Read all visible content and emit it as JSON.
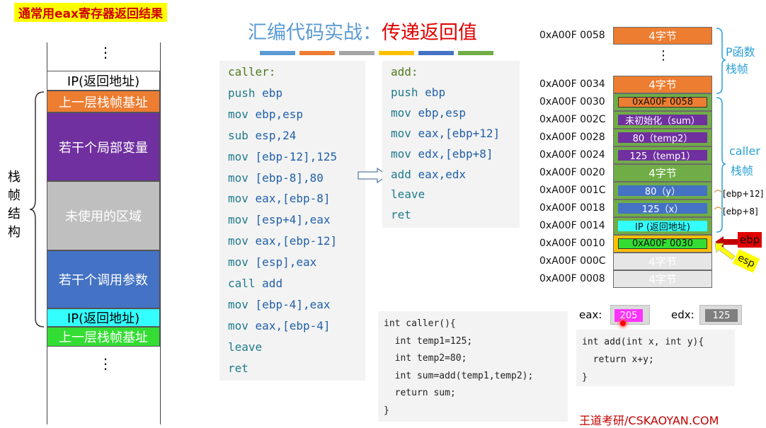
{
  "banner": "通常用eax寄存器返回结果",
  "title": {
    "part1": "汇编代码实战：",
    "part2": "传递返回值"
  },
  "color_bars": [
    "#5b9bd5",
    "#ed7d31",
    "#a5a5a5",
    "#ffc000",
    "#4472c4",
    "#70ad47"
  ],
  "left_stack": {
    "side_label": "栈帧结构",
    "ellipsis": "⋮",
    "rows": [
      {
        "label": "IP(返回地址)",
        "color": "#ffffff",
        "text_color": "#000000"
      },
      {
        "label": "上一层栈帧基址",
        "color": "#ed7d31",
        "text_color": "#ffffff"
      },
      {
        "label": "若干个局部变量",
        "color": "#7030a0",
        "text_color": "#ffffff"
      },
      {
        "label": "未使用的区域",
        "color": "#bfbfbf",
        "text_color": "#ffffff"
      },
      {
        "label": "若干个调用参数",
        "color": "#4472c4",
        "text_color": "#ffffff"
      },
      {
        "label": "IP(返回地址)",
        "color": "#33ffff",
        "text_color": "#000000"
      },
      {
        "label": "上一层栈帧基址",
        "color": "#33dd33",
        "text_color": "#ffffff"
      }
    ]
  },
  "caller_asm": [
    {
      "type": "label",
      "text": "caller:"
    },
    {
      "type": "ins",
      "op": "push",
      "args": "ebp"
    },
    {
      "type": "ins",
      "op": "mov",
      "args": "ebp,esp"
    },
    {
      "type": "ins",
      "op": "sub",
      "args": "esp,24"
    },
    {
      "type": "ins",
      "op": "mov",
      "args": "[ebp-12],125"
    },
    {
      "type": "ins",
      "op": "mov",
      "args": "[ebp-8],80"
    },
    {
      "type": "ins",
      "op": "mov",
      "args": "eax,[ebp-8]"
    },
    {
      "type": "ins",
      "op": "mov",
      "args": "[esp+4],eax"
    },
    {
      "type": "ins",
      "op": "mov",
      "args": "eax,[ebp-12]"
    },
    {
      "type": "ins",
      "op": "mov",
      "args": "[esp],eax"
    },
    {
      "type": "ins",
      "op": "call",
      "args": "add"
    },
    {
      "type": "ins",
      "op": "mov",
      "args": "[ebp-4],eax"
    },
    {
      "type": "ins",
      "op": "mov",
      "args": "eax,[ebp-4]"
    },
    {
      "type": "ins",
      "op": "leave",
      "args": ""
    },
    {
      "type": "ins",
      "op": "ret",
      "args": ""
    }
  ],
  "add_asm": [
    {
      "type": "label",
      "text": "add:"
    },
    {
      "type": "ins",
      "op": "push",
      "args": "ebp"
    },
    {
      "type": "ins",
      "op": "mov",
      "args": "ebp,esp"
    },
    {
      "type": "ins",
      "op": "mov",
      "args": "eax,[ebp+12]"
    },
    {
      "type": "ins",
      "op": "mov",
      "args": "edx,[ebp+8]"
    },
    {
      "type": "ins",
      "op": "add",
      "args": "eax,edx"
    },
    {
      "type": "ins",
      "op": "leave",
      "args": ""
    },
    {
      "type": "ins",
      "op": "ret",
      "args": ""
    }
  ],
  "memory": {
    "addresses": [
      "0xA00F 0058",
      "0xA00F 0034",
      "0xA00F 0030",
      "0xA00F 002C",
      "0xA00F 0028",
      "0xA00F 0024",
      "0xA00F 0020",
      "0xA00F 001C",
      "0xA00F 0018",
      "0xA00F 0014",
      "0xA00F 0010",
      "0xA00F 000C",
      "0xA00F 0008"
    ],
    "ellipsis": "⋮",
    "cells": [
      {
        "label": "4字节",
        "bg": "#ed7d31",
        "inner": ""
      },
      {
        "label": "4字节",
        "bg": "#ed7d31",
        "inner": ""
      },
      {
        "label": "0xA00F 0058",
        "bg": "#70ad47",
        "inner": "#ed7d31"
      },
      {
        "label": "未初始化（sum）",
        "bg": "#70ad47",
        "inner": "#7030a0"
      },
      {
        "label": "80（temp2）",
        "bg": "#70ad47",
        "inner": "#7030a0"
      },
      {
        "label": "125（temp1）",
        "bg": "#70ad47",
        "inner": "#7030a0"
      },
      {
        "label": "4字节",
        "bg": "#70ad47",
        "inner": ""
      },
      {
        "label": "80（y）",
        "bg": "#70ad47",
        "inner": "#4472c4"
      },
      {
        "label": "125（x）",
        "bg": "#70ad47",
        "inner": "#4472c4"
      },
      {
        "label": "IP (返回地址)",
        "bg": "#70ad47",
        "inner": "#33ffff"
      },
      {
        "label": "0xA00F 0030",
        "bg": "#ffc000",
        "inner": "#33dd33"
      },
      {
        "label": "4字节",
        "bg": "#e7e6e6",
        "inner": ""
      },
      {
        "label": "4字节",
        "bg": "#e7e6e6",
        "inner": ""
      }
    ],
    "p_frame_label": "P函数栈帧",
    "caller_frame_label_1": "caller",
    "caller_frame_label_2": "栈帧",
    "ebp_plus12": "[ebp+12]",
    "ebp_plus8": "[ebp+8]",
    "ebp_label": "ebp",
    "esp_label": "esp"
  },
  "registers": {
    "eax_label": "eax:",
    "eax_value": "205",
    "edx_label": "edx:",
    "edx_value": "125"
  },
  "c_caller": [
    "int caller(){",
    "  int temp1=125;",
    "  int temp2=80;",
    "  int sum=add(temp1,temp2);",
    "  return sum;",
    "}"
  ],
  "c_add": [
    "int add(int x, int y){",
    "  return x+y;",
    "}"
  ],
  "watermark": "王道考研/CSKAOYAN.COM"
}
